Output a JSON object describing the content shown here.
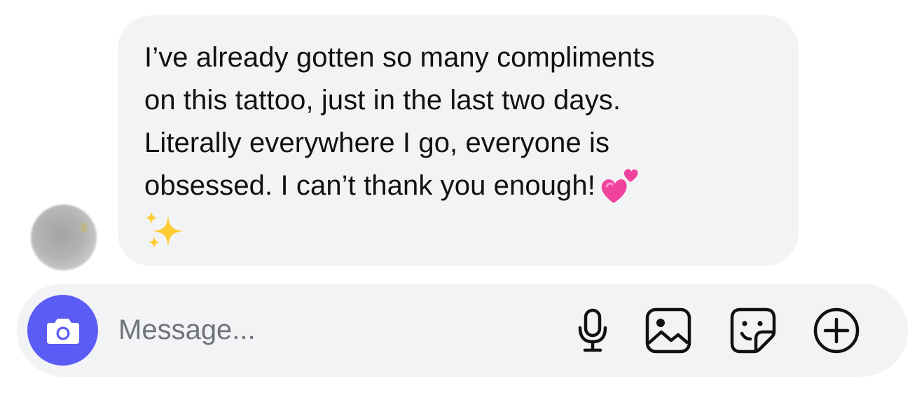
{
  "message": {
    "lines": [
      "I’ve already gotten so many compliments",
      "on this tattoo, just in the last two days.",
      "Literally everywhere I go, everyone is",
      "obsessed. I can’t thank you enough!"
    ],
    "emojis": [
      "two-hearts-emoji",
      "sparkles-emoji"
    ]
  },
  "composer": {
    "placeholder": "Message...",
    "buttons": [
      "camera-icon",
      "microphone-icon",
      "gallery-icon",
      "sticker-icon",
      "plus-icon"
    ],
    "accent_color": "#5b5cf5"
  },
  "colors": {
    "bubble_background": "#f2f3f5",
    "text": "#111111",
    "placeholder": "#707379"
  }
}
